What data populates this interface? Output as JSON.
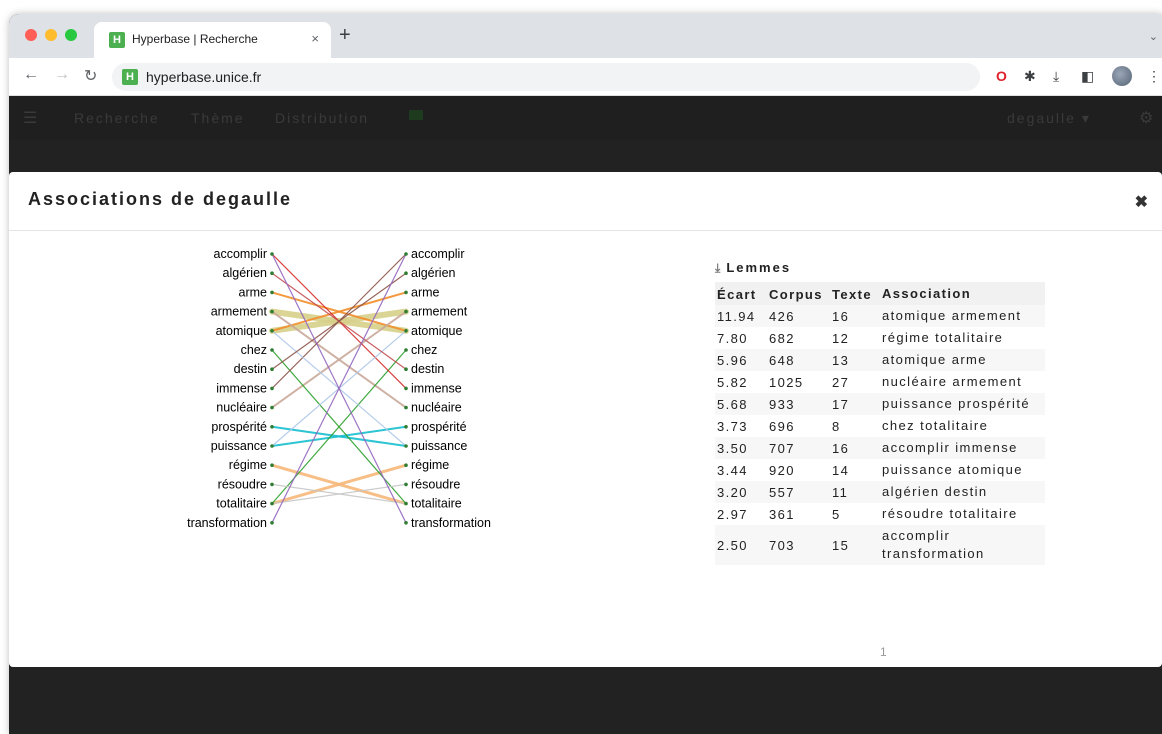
{
  "browser": {
    "tab_title": "Hyperbase | Recherche",
    "tab_close": "×",
    "new_tab": "+",
    "url": "hyperbase.unice.fr",
    "favicon_letter": "H"
  },
  "app_nav": {
    "items": [
      "Recherche",
      "Thème",
      "Distribution"
    ],
    "corpus": "degaulle ▾"
  },
  "modal": {
    "title": "Associations de degaulle",
    "close": "✖"
  },
  "graph": {
    "words": [
      "accomplir",
      "algérien",
      "arme",
      "armement",
      "atomique",
      "chez",
      "destin",
      "immense",
      "nucléaire",
      "prospérité",
      "puissance",
      "régime",
      "résoudre",
      "totalitaire",
      "transformation"
    ],
    "links": [
      {
        "from": "atomique",
        "to": "armement",
        "color": "#d6d08a",
        "weight": 6
      },
      {
        "from": "armement",
        "to": "atomique",
        "color": "#d6d08a",
        "weight": 6
      },
      {
        "from": "régime",
        "to": "totalitaire",
        "color": "#f7b77a",
        "weight": 3
      },
      {
        "from": "totalitaire",
        "to": "régime",
        "color": "#f7b77a",
        "weight": 3
      },
      {
        "from": "atomique",
        "to": "arme",
        "color": "#f28e2b",
        "weight": 2
      },
      {
        "from": "arme",
        "to": "atomique",
        "color": "#f28e2b",
        "weight": 2
      },
      {
        "from": "nucléaire",
        "to": "armement",
        "color": "#c9a99a",
        "weight": 2
      },
      {
        "from": "armement",
        "to": "nucléaire",
        "color": "#c9a99a",
        "weight": 2
      },
      {
        "from": "puissance",
        "to": "prospérité",
        "color": "#17becf",
        "weight": 2
      },
      {
        "from": "prospérité",
        "to": "puissance",
        "color": "#17becf",
        "weight": 2
      },
      {
        "from": "chez",
        "to": "totalitaire",
        "color": "#2ca02c",
        "weight": 1.2
      },
      {
        "from": "totalitaire",
        "to": "chez",
        "color": "#2ca02c",
        "weight": 1.2
      },
      {
        "from": "accomplir",
        "to": "immense",
        "color": "#d62728",
        "weight": 1.2
      },
      {
        "from": "immense",
        "to": "accomplir",
        "color": "#8c564b",
        "weight": 1.2
      },
      {
        "from": "puissance",
        "to": "atomique",
        "color": "#aec7e8",
        "weight": 1.2
      },
      {
        "from": "atomique",
        "to": "puissance",
        "color": "#aec7e8",
        "weight": 1.2
      },
      {
        "from": "algérien",
        "to": "destin",
        "color": "#c44e52",
        "weight": 1.2
      },
      {
        "from": "destin",
        "to": "algérien",
        "color": "#8c564b",
        "weight": 1.2
      },
      {
        "from": "résoudre",
        "to": "totalitaire",
        "color": "#c7c7c7",
        "weight": 1.2
      },
      {
        "from": "totalitaire",
        "to": "résoudre",
        "color": "#c7c7c7",
        "weight": 1.2
      },
      {
        "from": "accomplir",
        "to": "transformation",
        "color": "#9467bd",
        "weight": 1.2
      },
      {
        "from": "transformation",
        "to": "accomplir",
        "color": "#9467bd",
        "weight": 1.2
      }
    ]
  },
  "table": {
    "heading": "Lemmes",
    "columns": [
      "Écart",
      "Corpus",
      "Texte",
      "Association"
    ],
    "rows": [
      [
        "11.94",
        "426",
        "16",
        "atomique armement"
      ],
      [
        "7.80",
        "682",
        "12",
        "régime totalitaire"
      ],
      [
        "5.96",
        "648",
        "13",
        "atomique arme"
      ],
      [
        "5.82",
        "1025",
        "27",
        "nucléaire armement"
      ],
      [
        "5.68",
        "933",
        "17",
        "puissance prospérité"
      ],
      [
        "3.73",
        "696",
        "8",
        "chez totalitaire"
      ],
      [
        "3.50",
        "707",
        "16",
        "accomplir immense"
      ],
      [
        "3.44",
        "920",
        "14",
        "puissance atomique"
      ],
      [
        "3.20",
        "557",
        "11",
        "algérien destin"
      ],
      [
        "2.97",
        "361",
        "5",
        "résoudre totalitaire"
      ],
      [
        "2.50",
        "703",
        "15",
        "accomplir transformation"
      ]
    ],
    "page": "1"
  }
}
